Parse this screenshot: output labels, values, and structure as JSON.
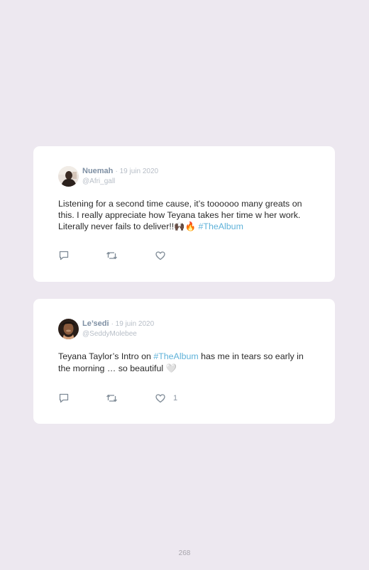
{
  "tweets": [
    {
      "author": "Nuemah",
      "date": "· 19 juin 2020",
      "handle": "@Afri_gall",
      "text_before": "Listening for a second time cause, it’s toooooo many greats on this. I really appreciate how Teyana takes her time w her work. Literally never fails to deliver!!",
      "emoji": "🙌🏿🔥",
      "hashtag": "#TheAlbum",
      "text_after": "",
      "likes": ""
    },
    {
      "author": "Le’sedi",
      "date": "· 19 juin 2020",
      "handle": "@SeddyMolebee",
      "text_before": "Teyana Taylor’s Intro on ",
      "hashtag": "#TheAlbum",
      "text_after": " has me in tears so early in the morning … so beautiful ",
      "emoji": "🤍",
      "likes": "1"
    }
  ],
  "page_number": "268",
  "colors": {
    "background": "#ede8f0",
    "card": "#ffffff",
    "author": "#7e8fa3",
    "muted": "#b7bec7",
    "hashtag": "#5fb2d9",
    "text": "#2a2a2a"
  },
  "icons": [
    "reply-icon",
    "retweet-icon",
    "like-icon"
  ]
}
